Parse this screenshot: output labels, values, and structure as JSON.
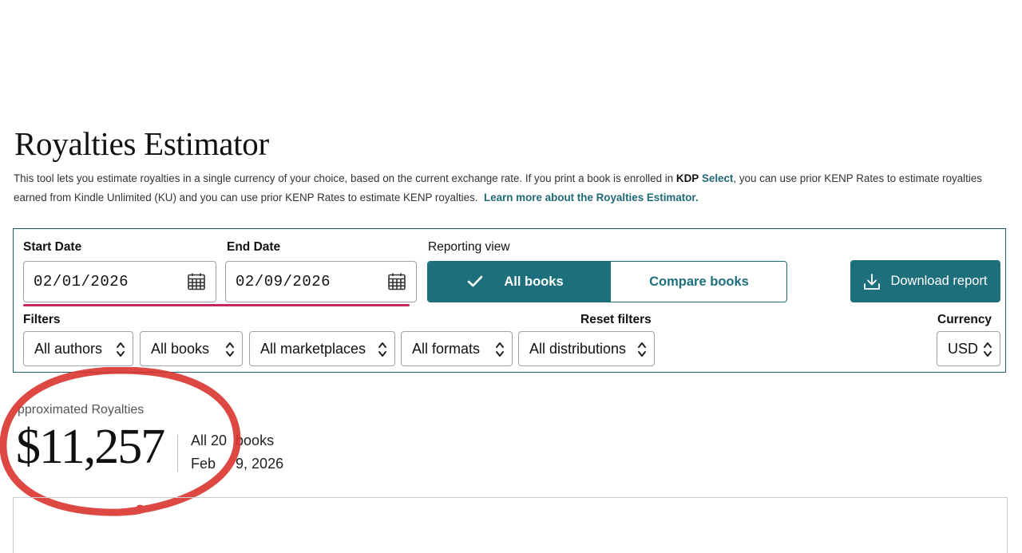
{
  "page": {
    "title": "Royalties Estimator",
    "description": {
      "part1": "This tool lets you estimate royalties in a single currency of your choice, based on the current exchange rate.  If you print a book is enrolled in ",
      "kdp": "KDP",
      "select": "Select",
      "part2": ", you can use prior KENP Rates to estimate royalties earned from Kindle Unlimited (KU) and you can use prior KENP Rates to estimate KENP royalties.",
      "learn_more": "Learn more about the Royalties Estimator."
    }
  },
  "dates": {
    "start_label": "Start Date",
    "start_value": "02/01/2026",
    "end_label": "End Date",
    "end_value": "02/09/2026",
    "icon": "calendar-icon"
  },
  "reporting": {
    "label": "Reporting view",
    "options": [
      "All books",
      "Compare books"
    ],
    "selected": "All books"
  },
  "download": {
    "label": "Download report",
    "icon": "download-icon"
  },
  "filters": {
    "label": "Filters",
    "reset_label": "Reset filters",
    "authors": "All authors",
    "books": "All books",
    "marketplaces": "All marketplaces",
    "formats": "All formats",
    "distributions": "All distributions"
  },
  "currency": {
    "label": "Currency",
    "value": "USD"
  },
  "summary": {
    "label": "pproximated Royalties",
    "amount": "$11,257",
    "scope_a": "All 20",
    "scope_b": " books",
    "range_a": "Feb",
    "range_b": " 9, 2026"
  },
  "colors": {
    "accent": "#1d6f7c",
    "panel_border": "#1d5e69",
    "underline": "#c3295a",
    "annotation": "#d9342f"
  }
}
